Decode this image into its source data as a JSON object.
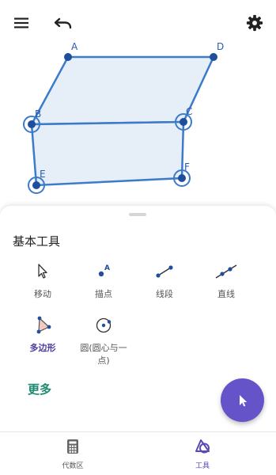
{
  "canvas": {
    "points": [
      {
        "name": "A"
      },
      {
        "name": "D"
      },
      {
        "name": "B"
      },
      {
        "name": "C"
      },
      {
        "name": "E"
      },
      {
        "name": "F"
      }
    ]
  },
  "sheet": {
    "title": "基本工具",
    "tools": [
      {
        "label": "移动",
        "icon": "move-pointer-icon"
      },
      {
        "label": "描点",
        "icon": "point-icon"
      },
      {
        "label": "线段",
        "icon": "segment-icon"
      },
      {
        "label": "直线",
        "icon": "line-icon"
      },
      {
        "label": "多边形",
        "icon": "polygon-icon",
        "active": true
      },
      {
        "label": "圆(圆心与一点)",
        "icon": "circle-center-point-icon"
      }
    ],
    "more_label": "更多"
  },
  "nav": {
    "items": [
      {
        "label": "代数区",
        "icon": "calculator-icon"
      },
      {
        "label": "工具",
        "icon": "tools-icon",
        "active": true
      }
    ]
  },
  "colors": {
    "accent": "#6553c9",
    "point": "#1f4e9c",
    "polygon_stroke": "#3b7bc8",
    "polygon_fill": "#dde8f6",
    "more_link": "#1c8a70"
  }
}
